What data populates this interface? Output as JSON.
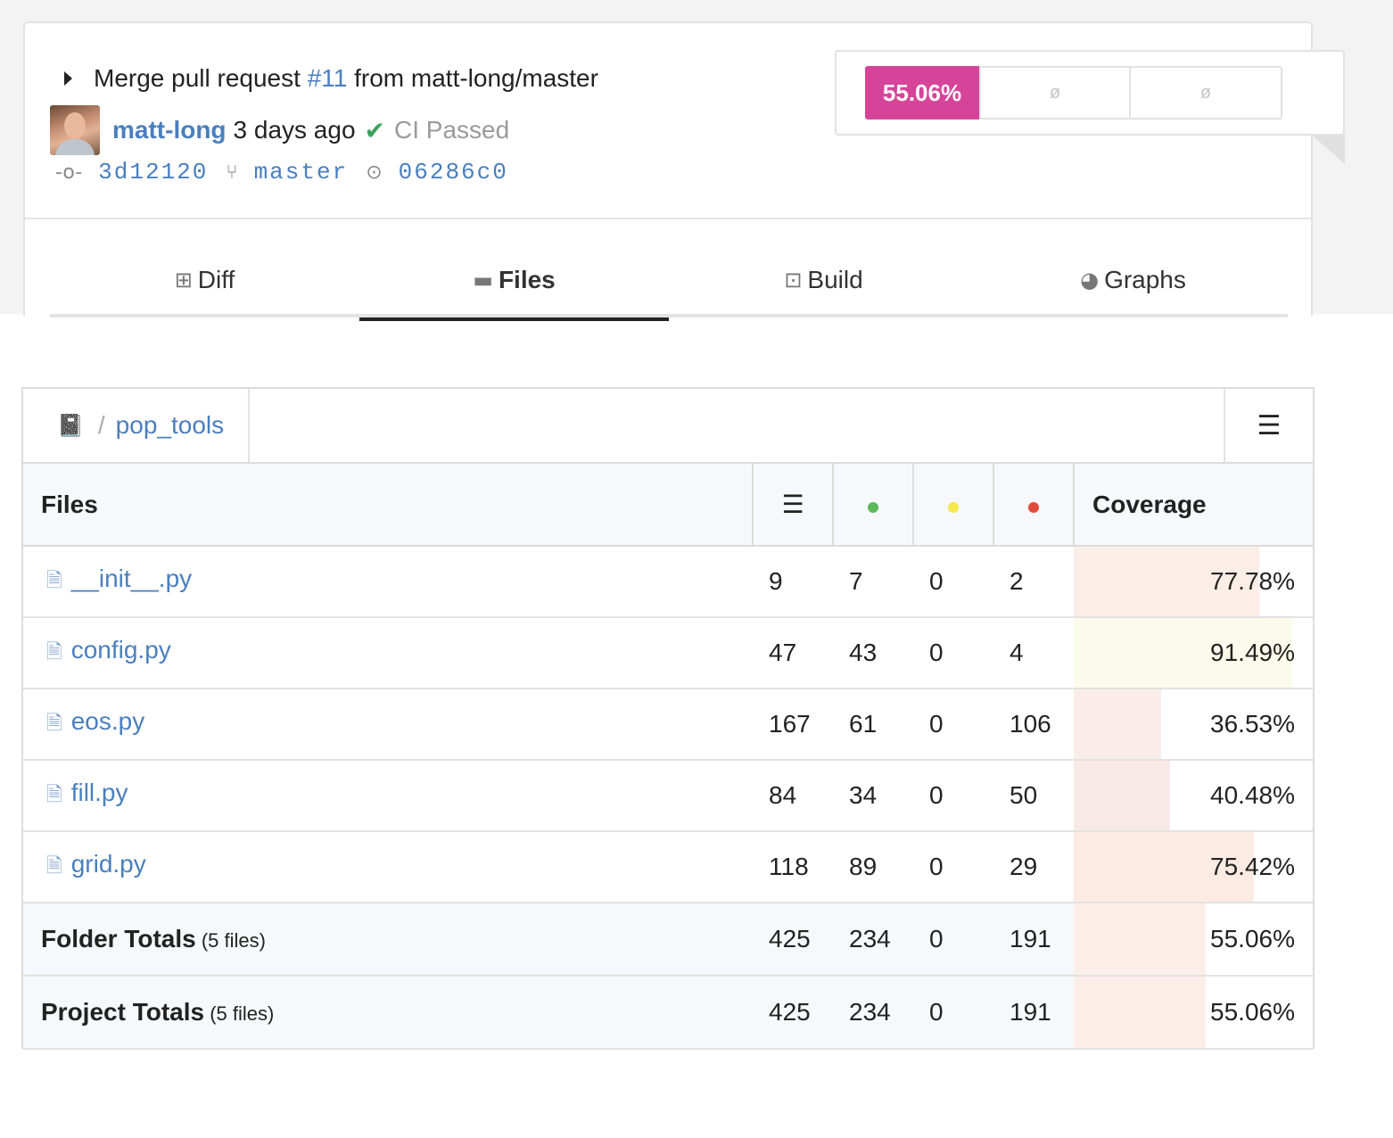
{
  "commit": {
    "message_prefix": "Merge pull request",
    "pr_link": "#11",
    "message_suffix": "from matt-long/master",
    "author": "matt-long",
    "time_ago": "3 days ago",
    "ci_status": "CI Passed",
    "commit_sha": "3d12120",
    "branch": "master",
    "parent_sha": "06286c0"
  },
  "coverage_badge": {
    "value": "55.06%",
    "change": "ø",
    "patch": "ø",
    "color": "#d6449a"
  },
  "tabs": [
    {
      "label": "Diff",
      "icon": "diff-icon",
      "active": false
    },
    {
      "label": "Files",
      "icon": "folder-icon",
      "active": true
    },
    {
      "label": "Build",
      "icon": "box-icon",
      "active": false
    },
    {
      "label": "Graphs",
      "icon": "pie-chart-icon",
      "active": false
    }
  ],
  "breadcrumb": {
    "root_icon": "book-icon",
    "separator": "/",
    "folder": "pop_tools"
  },
  "table": {
    "headers": {
      "files": "Files",
      "coverage": "Coverage"
    },
    "rows": [
      {
        "name": "__init__.py",
        "lines": "9",
        "hits": "7",
        "partials": "0",
        "misses": "2",
        "coverage": "77.78%",
        "coverage_fraction": 0.7778,
        "bar_color": "#fbeee6"
      },
      {
        "name": "config.py",
        "lines": "47",
        "hits": "43",
        "partials": "0",
        "misses": "4",
        "coverage": "91.49%",
        "coverage_fraction": 0.9149,
        "bar_color": "#fafbea"
      },
      {
        "name": "eos.py",
        "lines": "167",
        "hits": "61",
        "partials": "0",
        "misses": "106",
        "coverage": "36.53%",
        "coverage_fraction": 0.3653,
        "bar_color": "#faece8"
      },
      {
        "name": "fill.py",
        "lines": "84",
        "hits": "34",
        "partials": "0",
        "misses": "50",
        "coverage": "40.48%",
        "coverage_fraction": 0.4048,
        "bar_color": "#f8ebe7"
      },
      {
        "name": "grid.py",
        "lines": "118",
        "hits": "89",
        "partials": "0",
        "misses": "29",
        "coverage": "75.42%",
        "coverage_fraction": 0.7542,
        "bar_color": "#fcebe3"
      }
    ],
    "totals": [
      {
        "label": "Folder Totals",
        "note": "(5 files)",
        "lines": "425",
        "hits": "234",
        "partials": "0",
        "misses": "191",
        "coverage": "55.06%",
        "coverage_fraction": 0.5506,
        "bar_color": "#fbeee9"
      },
      {
        "label": "Project Totals",
        "note": "(5 files)",
        "lines": "425",
        "hits": "234",
        "partials": "0",
        "misses": "191",
        "coverage": "55.06%",
        "coverage_fraction": 0.5506,
        "bar_color": "#fbeee9"
      }
    ],
    "legend_colors": {
      "hit": "#5cb85c",
      "partial": "#f5e84b",
      "miss": "#e14b3b"
    }
  }
}
